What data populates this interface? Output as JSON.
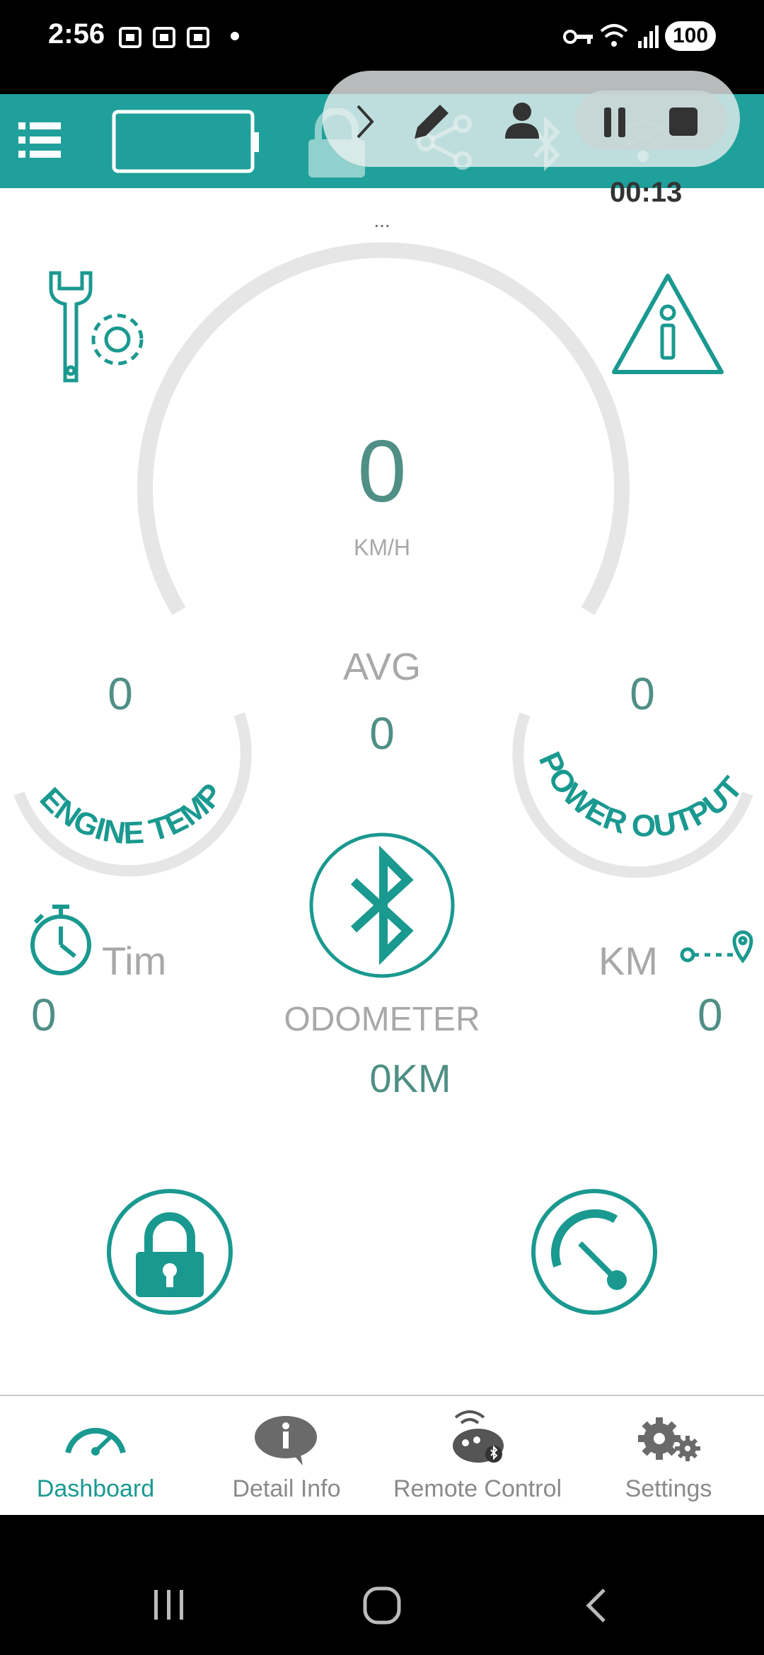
{
  "status_bar": {
    "time": "2:56",
    "battery": "100"
  },
  "toolbar": {
    "menu_icon": "list-icon",
    "battery_icon": "battery-outline-icon"
  },
  "recording": {
    "timer": "00:13"
  },
  "speedometer": {
    "top_dots": "...",
    "speed": "0",
    "unit": "KM/H"
  },
  "avg": {
    "label": "AVG",
    "value": "0"
  },
  "engine_temp": {
    "value": "0",
    "label": "ENGINE TEMP"
  },
  "power_output": {
    "value": "0",
    "label": "POWER OUTPUT"
  },
  "time_block": {
    "label": "Tim",
    "value": "0"
  },
  "km_block": {
    "label": "KM",
    "value": "0"
  },
  "odometer": {
    "label": "ODOMETER",
    "value": "0KM"
  },
  "bottom_nav": {
    "items": [
      {
        "label": "Dashboard",
        "icon": "speedometer-icon",
        "active": true
      },
      {
        "label": "Detail Info",
        "icon": "info-bubble-icon",
        "active": false
      },
      {
        "label": "Remote Control",
        "icon": "remote-control-icon",
        "active": false
      },
      {
        "label": "Settings",
        "icon": "gears-icon",
        "active": false
      }
    ]
  },
  "colors": {
    "primary": "#20a09a",
    "accent": "#1a9990",
    "numbers": "#4f8f85",
    "label_grey": "#a8a8a8",
    "gauge_track": "#e6e6e6"
  }
}
